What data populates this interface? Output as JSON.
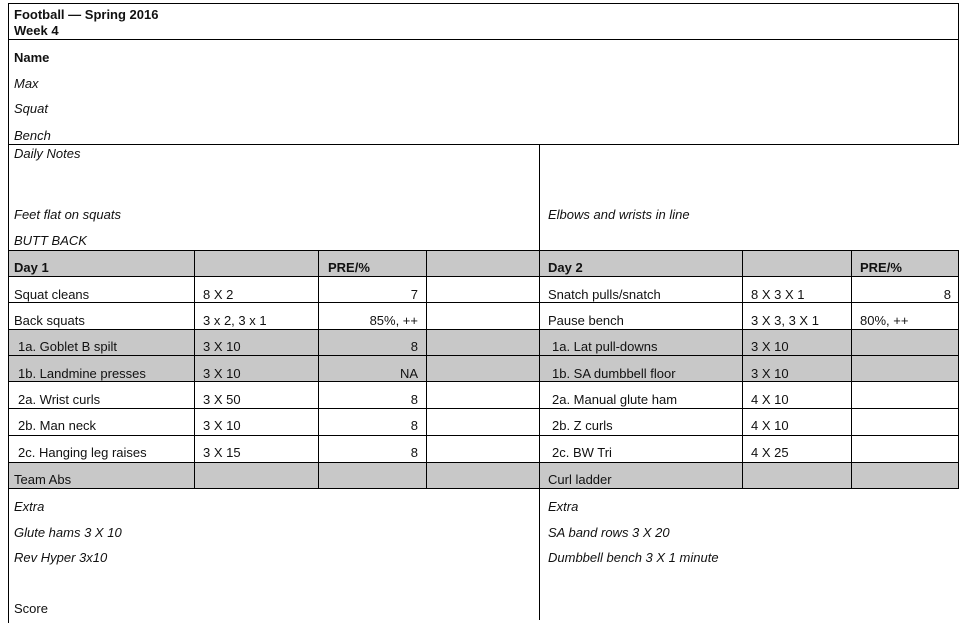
{
  "header": {
    "title": "Football — Spring 2016",
    "week": "Week 4"
  },
  "info": {
    "name": "Name",
    "max": "Max",
    "squat": "Squat",
    "bench": "Bench"
  },
  "notes": {
    "label": "Daily Notes",
    "left": [
      "Feet flat on squats",
      "BUTT BACK"
    ],
    "right": [
      "Elbows and wrists in line"
    ]
  },
  "day1": {
    "header": {
      "name": "Day 1",
      "pre": "PRE/%"
    },
    "rows": [
      {
        "name": "Squat cleans",
        "sets": "8 X 2",
        "pre": "7"
      },
      {
        "name": "Back squats",
        "sets": "3 x 2, 3 x 1",
        "pre": "85%, ++"
      },
      {
        "name": "1a. Goblet B spilt",
        "sets": "3 X 10",
        "pre": "8"
      },
      {
        "name": "1b. Landmine presses",
        "sets": "3 X 10",
        "pre": "NA"
      },
      {
        "name": "2a. Wrist curls",
        "sets": "3 X 50",
        "pre": "8"
      },
      {
        "name": "2b. Man neck",
        "sets": "3 X 10",
        "pre": "8"
      },
      {
        "name": "2c. Hanging leg raises",
        "sets": "3 X 15",
        "pre": "8"
      },
      {
        "name": "Team Abs",
        "sets": "",
        "pre": ""
      }
    ]
  },
  "day2": {
    "header": {
      "name": "Day 2",
      "pre": "PRE/%"
    },
    "rows": [
      {
        "name": "Snatch pulls/snatch",
        "sets": "8 X 3 X 1",
        "pre": "8"
      },
      {
        "name": "Pause bench",
        "sets": "3 X 3, 3 X 1",
        "pre": "80%, ++"
      },
      {
        "name": "1a. Lat pull-downs",
        "sets": "3 X 10",
        "pre": ""
      },
      {
        "name": "1b. SA dumbbell floor",
        "sets": "3 X 10",
        "pre": ""
      },
      {
        "name": "2a. Manual glute ham",
        "sets": "4 X 10",
        "pre": ""
      },
      {
        "name": "2b. Z curls",
        "sets": "4 X 10",
        "pre": ""
      },
      {
        "name": "2c. BW Tri",
        "sets": "4 X 25",
        "pre": ""
      },
      {
        "name": "Curl ladder",
        "sets": "",
        "pre": ""
      }
    ]
  },
  "extra": {
    "left": {
      "label": "Extra",
      "items": [
        "Glute hams 3 X 10",
        "Rev Hyper 3x10"
      ]
    },
    "right": {
      "label": "Extra",
      "items": [
        "SA band rows 3 X 20",
        "Dumbbell bench 3 X 1 minute"
      ]
    }
  },
  "score": "Score"
}
